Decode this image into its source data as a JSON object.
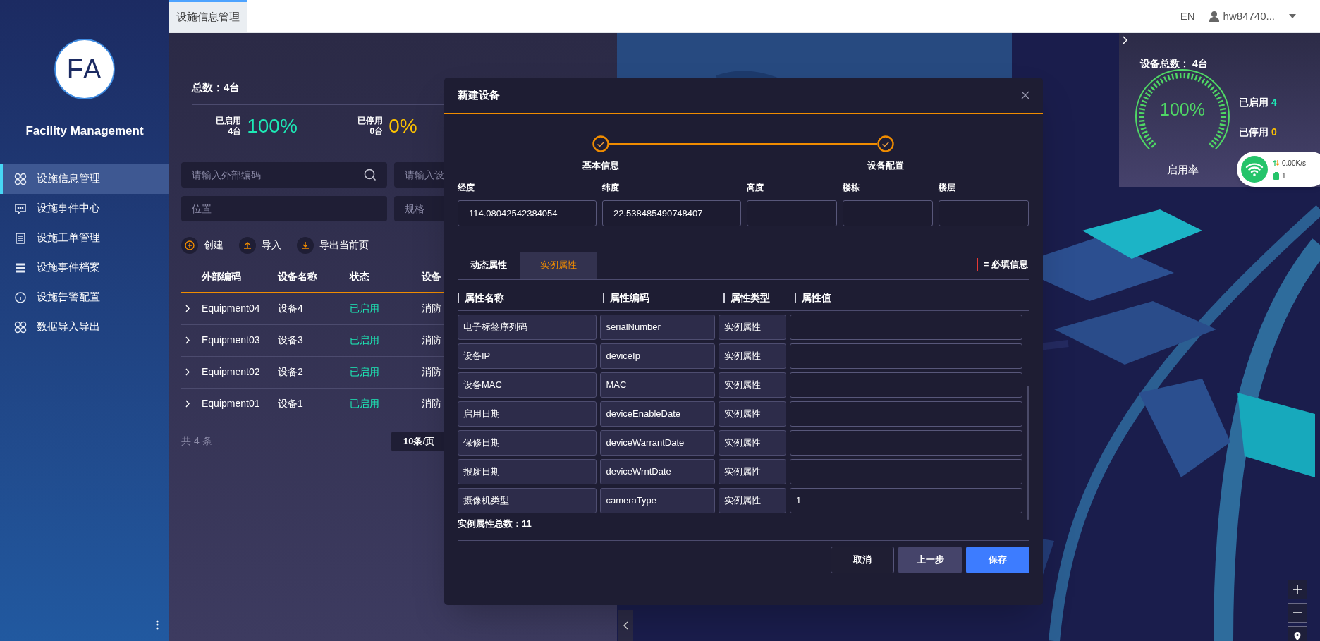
{
  "app": {
    "logo": "FA",
    "name": "Facility Management"
  },
  "sidebar": {
    "items": [
      {
        "kind": "grid",
        "label": "设施信息管理",
        "selected": true
      },
      {
        "kind": "chat",
        "label": "设施事件中心",
        "selected": false
      },
      {
        "kind": "doc",
        "label": "设施工单管理",
        "selected": false
      },
      {
        "kind": "list",
        "label": "设施事件档案",
        "selected": false
      },
      {
        "kind": "info",
        "label": "设施告警配置",
        "selected": false
      },
      {
        "kind": "grid",
        "label": "数据导入导出",
        "selected": false
      }
    ]
  },
  "top_bar": {
    "tabs": [
      {
        "label": "设施信息管理",
        "selected": true
      }
    ],
    "language": "EN",
    "user": "hw84740..."
  },
  "summary": {
    "total": "总数：4台",
    "stats": [
      {
        "label": "已启用",
        "count": "4台",
        "percent": "100%",
        "color": "#1de9b6"
      },
      {
        "label": "已停用",
        "count": "0台",
        "percent": "0%",
        "color": "#ffc400"
      }
    ]
  },
  "filters": [
    {
      "placeholder": "请输入外部编码",
      "search": true
    },
    {
      "placeholder": "请输入设",
      "search": false
    },
    {
      "placeholder": "位置",
      "search": false
    },
    {
      "placeholder": "规格",
      "search": false
    }
  ],
  "actions": [
    {
      "kind": "create",
      "label": "创建"
    },
    {
      "kind": "import",
      "label": "导入"
    },
    {
      "kind": "export",
      "label": "导出当前页"
    }
  ],
  "table": {
    "columns": [
      "外部编码",
      "设备名称",
      "状态",
      "设备"
    ],
    "rows": [
      {
        "code": "Equipment04",
        "name": "设备4",
        "status": "已启用",
        "category": "消防"
      },
      {
        "code": "Equipment03",
        "name": "设备3",
        "status": "已启用",
        "category": "消防"
      },
      {
        "code": "Equipment02",
        "name": "设备2",
        "status": "已启用",
        "category": "消防"
      },
      {
        "code": "Equipment01",
        "name": "设备1",
        "status": "已启用",
        "category": "消防"
      }
    ]
  },
  "pagination": {
    "total": "共 4 条",
    "page_size": "10条/页"
  },
  "dialog": {
    "title": "新建设备",
    "steps": [
      {
        "label": "基本信息",
        "done": true
      },
      {
        "label": "设备配置",
        "done": true
      }
    ],
    "fields": [
      {
        "label": "经度",
        "value": "114.08042542384054"
      },
      {
        "label": "纬度",
        "value": "22.538485490748407"
      },
      {
        "label": "高度"
      },
      {
        "label": "楼栋"
      },
      {
        "label": "楼层"
      }
    ],
    "tabs": [
      {
        "label": "动态属性",
        "selected": false
      },
      {
        "label": "实例属性",
        "selected": true
      }
    ],
    "legend": "= 必填信息",
    "attributes": {
      "columns": [
        "属性名称",
        "属性编码",
        "属性类型",
        "属性值"
      ],
      "rows": [
        {
          "name": "电子标签序列码",
          "code": "serialNumber",
          "type": "实例属性"
        },
        {
          "name": "设备IP",
          "code": "deviceIp",
          "type": "实例属性"
        },
        {
          "name": "设备MAC",
          "code": "MAC",
          "type": "实例属性"
        },
        {
          "name": "启用日期",
          "code": "deviceEnableDate",
          "type": "实例属性"
        },
        {
          "name": "保修日期",
          "code": "deviceWarrantDate",
          "type": "实例属性"
        },
        {
          "name": "报废日期",
          "code": "deviceWrntDate",
          "type": "实例属性"
        },
        {
          "name": "摄像机类型",
          "code": "cameraType",
          "type": "实例属性",
          "value": "1"
        }
      ]
    },
    "count": "实例属性总数：11",
    "buttons": [
      {
        "kind": "cancel",
        "label": "取消"
      },
      {
        "kind": "back",
        "label": "上一步"
      },
      {
        "kind": "primary",
        "label": "保存"
      }
    ]
  },
  "overview": {
    "total": "设备总数： 4台",
    "gauge": {
      "value": "100%",
      "label": "启用率",
      "level": 1
    },
    "stats": [
      {
        "label": "已启用",
        "value": "4",
        "color": "#1de9b6"
      },
      {
        "label": "已停用",
        "value": "0",
        "color": "#ffc400"
      }
    ]
  },
  "network": {
    "speed": "0.00K/s",
    "count": "1"
  }
}
